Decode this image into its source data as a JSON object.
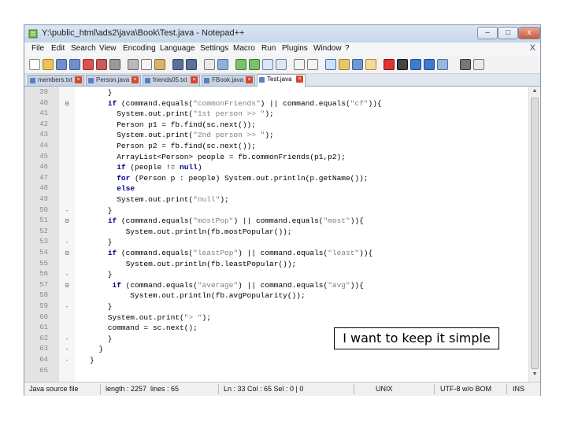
{
  "window": {
    "title": "Y:\\public_html\\ads2\\java\\Book\\Test.java - Notepad++",
    "controls": {
      "minimize": "–",
      "maximize": "□",
      "close": "x"
    }
  },
  "menu": {
    "items": [
      "File",
      "Edit",
      "Search",
      "View",
      "Encoding",
      "Language",
      "Settings",
      "Macro",
      "Run",
      "Plugins",
      "Window",
      "?"
    ],
    "close_glyph": "X"
  },
  "tabs": [
    {
      "label": "members.txt",
      "active": false
    },
    {
      "label": "Person.java",
      "active": false
    },
    {
      "label": "friends05.txt",
      "active": false
    },
    {
      "label": "FBook.java",
      "active": false
    },
    {
      "label": "Test.java",
      "active": true
    }
  ],
  "code_lines": [
    {
      "n": "39",
      "fold": "",
      "text": "    }"
    },
    {
      "n": "40",
      "fold": "⊟",
      "text": "    if (command.equals(\"commonFriends\") || command.equals(\"cf\")){"
    },
    {
      "n": "41",
      "fold": "",
      "text": "      System.out.print(\"1st person >> \");"
    },
    {
      "n": "42",
      "fold": "",
      "text": "      Person p1 = fb.find(sc.next());"
    },
    {
      "n": "43",
      "fold": "",
      "text": "      System.out.print(\"2nd person >> \");"
    },
    {
      "n": "44",
      "fold": "",
      "text": "      Person p2 = fb.find(sc.next());"
    },
    {
      "n": "45",
      "fold": "",
      "text": "      ArrayList<Person> people = fb.commonFriends(p1,p2);"
    },
    {
      "n": "46",
      "fold": "",
      "text": "      if (people != null)"
    },
    {
      "n": "47",
      "fold": "",
      "text": "      for (Person p : people) System.out.println(p.getName());"
    },
    {
      "n": "48",
      "fold": "",
      "text": "      else"
    },
    {
      "n": "49",
      "fold": "",
      "text": "      System.out.print(\"null\");"
    },
    {
      "n": "50",
      "fold": "-",
      "text": "    }"
    },
    {
      "n": "51",
      "fold": "⊟",
      "text": "    if (command.equals(\"mostPop\") || command.equals(\"most\")){"
    },
    {
      "n": "52",
      "fold": "",
      "text": "        System.out.println(fb.mostPopular());"
    },
    {
      "n": "53",
      "fold": "-",
      "text": "    }"
    },
    {
      "n": "54",
      "fold": "⊟",
      "text": "    if (command.equals(\"leastPop\") || command.equals(\"least\")){"
    },
    {
      "n": "55",
      "fold": "",
      "text": "        System.out.println(fb.leastPopular());"
    },
    {
      "n": "56",
      "fold": "-",
      "text": "    }"
    },
    {
      "n": "57",
      "fold": "⊟",
      "text": "     if (command.equals(\"average\") || command.equals(\"avg\")){"
    },
    {
      "n": "58",
      "fold": "",
      "text": "         System.out.println(fb.avgPopularity());"
    },
    {
      "n": "59",
      "fold": "-",
      "text": "    }"
    },
    {
      "n": "60",
      "fold": "",
      "text": "    System.out.print(\"> \");"
    },
    {
      "n": "61",
      "fold": "",
      "text": "    command = sc.next();"
    },
    {
      "n": "62",
      "fold": "-",
      "text": "    }"
    },
    {
      "n": "63",
      "fold": "-",
      "text": "  }"
    },
    {
      "n": "64",
      "fold": "-",
      "text": "}"
    },
    {
      "n": "65",
      "fold": "",
      "text": ""
    }
  ],
  "status": {
    "file_type": "Java source file",
    "length": "length : 2257",
    "lines": "lines : 65",
    "position": "Ln : 33    Col : 65    Sel : 0 | 0",
    "eol": "UNIX",
    "encoding": "UTF-8 w/o BOM",
    "mode": "INS"
  },
  "callout": {
    "text": "I want to keep it simple"
  },
  "colors": {
    "keyword": "#00008b",
    "string": "#808080",
    "gutter": "#e4e4e4"
  }
}
